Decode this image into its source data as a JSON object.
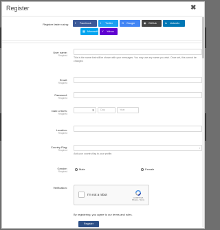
{
  "modal": {
    "title": "Register",
    "close_label": "✖"
  },
  "social": {
    "label": "Register faster using:",
    "buttons": [
      {
        "label": "Facebook",
        "icon": "f",
        "color": "#3b5998"
      },
      {
        "label": "Twitter",
        "icon": "t",
        "color": "#1da1f2"
      },
      {
        "label": "Google",
        "icon": "G",
        "color": "#4285f4"
      },
      {
        "label": "GitHub",
        "icon": "◉",
        "color": "#444444"
      },
      {
        "label": "LinkedIn",
        "icon": "in",
        "color": "#0077b5"
      },
      {
        "label": "Microsoft",
        "icon": "▦",
        "color": "#00a4ef"
      },
      {
        "label": "Yahoo",
        "icon": "Y",
        "color": "#5f01d1"
      }
    ]
  },
  "fields": {
    "username": {
      "label": "User name:",
      "required": "Required",
      "hint": "This is the name that will be shown with your messages. You may use any name you wish. Once set, this cannot be changed."
    },
    "email": {
      "label": "Email:",
      "required": "Required"
    },
    "password": {
      "label": "Password:",
      "required": "Required"
    },
    "dob": {
      "label": "Date of birth:",
      "required": "Required",
      "day_placeholder": "Day",
      "year_placeholder": "Year"
    },
    "location": {
      "label": "Location:",
      "required": "Required"
    },
    "country_flag": {
      "label": "Country Flag:",
      "required": "Required",
      "hint": "Add your country flag to your profile."
    },
    "gender": {
      "label": "Gender:",
      "required": "Required",
      "options": [
        "Male",
        "Female"
      ]
    },
    "verification": {
      "label": "Verification:"
    }
  },
  "captcha": {
    "label": "I'm not a robot",
    "brand": "reCAPTCHA",
    "links": "Privacy - Terms"
  },
  "footer": {
    "terms": "By registering, you agree to our terms and rules.",
    "register_label": "Register"
  }
}
